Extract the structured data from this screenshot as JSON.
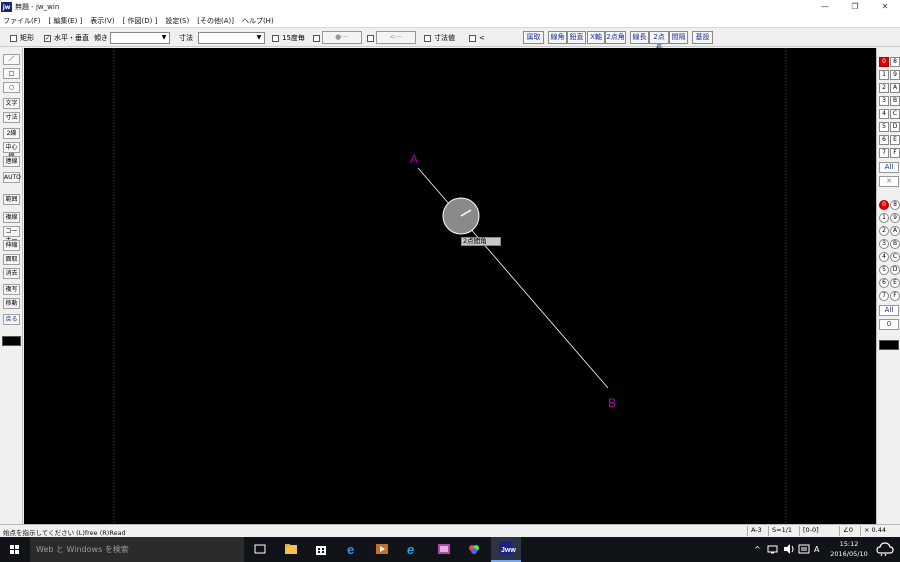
{
  "window": {
    "app_icon_text": "jw",
    "title": "無題 - jw_win",
    "controls": [
      "—",
      "❐",
      "✕"
    ]
  },
  "menu": [
    "ファイル(F)",
    "[ 編集(E) ]",
    "表示(V)",
    "[ 作図(D) ]",
    "設定(S)",
    "[その他(A)]",
    "ヘルプ(H)"
  ],
  "toolbar": {
    "rect_label": "矩形",
    "hv_label": "水平・垂直",
    "hv_checked": true,
    "ratio_label": "傾き",
    "dim_label": "寸法",
    "deg15_label": "15度毎",
    "dash_btn1": "●---",
    "dash_btn2": "<---",
    "dimvalue_label": "寸法値",
    "lt_label": "<",
    "right_buttons": [
      "属取",
      "線角",
      "鉛直",
      "X軸",
      "2点角",
      "線長",
      "2点長",
      "間隔",
      "基設"
    ]
  },
  "left_tools": [
    "／",
    "□",
    "○",
    "文字",
    "寸法",
    "2線",
    "中心線",
    "連線",
    "AUTO",
    "範囲",
    "複線",
    "コーナー",
    "伸縮",
    "面取",
    "消去",
    "複写",
    "移動",
    "戻る"
  ],
  "layers": {
    "group_rows": [
      [
        "0",
        "8"
      ],
      [
        "1",
        "9"
      ],
      [
        "2",
        "A"
      ],
      [
        "3",
        "B"
      ],
      [
        "4",
        "C"
      ],
      [
        "5",
        "D"
      ],
      [
        "6",
        "E"
      ],
      [
        "7",
        "F"
      ]
    ],
    "layer_rows": [
      [
        "0",
        "8"
      ],
      [
        "1",
        "9"
      ],
      [
        "2",
        "A"
      ],
      [
        "3",
        "B"
      ],
      [
        "4",
        "C"
      ],
      [
        "5",
        "D"
      ],
      [
        "6",
        "E"
      ],
      [
        "7",
        "F"
      ]
    ],
    "all_label": "All",
    "x_label": "✕",
    "all_label2": "All",
    "zero_label": "0"
  },
  "canvas": {
    "point_a_label": "A",
    "point_b_label": "B",
    "tooltip_label": "2点間角",
    "colors": {
      "background": "#000000",
      "label": "#b000b0",
      "frame": "#8a1a8a",
      "line": "#ffffff"
    }
  },
  "status": {
    "message": "始点を指示してください (L)free (R)Read",
    "paper": "A-3",
    "scale": "S=1/1",
    "layer": "[0-0]",
    "angle": "∠0",
    "zoom": "× 0.44"
  },
  "taskbar": {
    "search_placeholder": "Web と Windows を検索",
    "ime": "A",
    "time": "15:12",
    "date": "2016/05/10"
  }
}
